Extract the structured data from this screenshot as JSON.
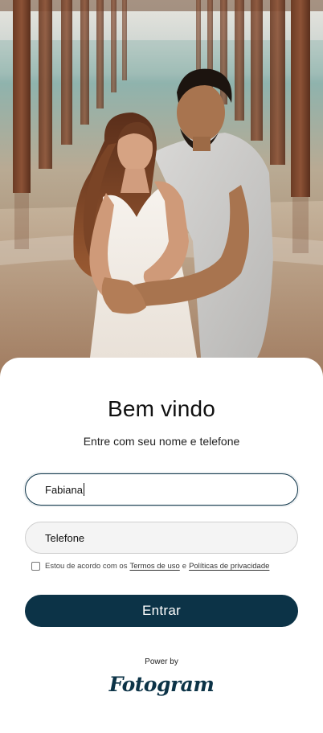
{
  "welcome": {
    "title": "Bem vindo",
    "subtitle": "Entre com seu nome e telefone"
  },
  "form": {
    "name_value": "Fabiana",
    "phone_placeholder": "Telefone",
    "consent_prefix": "Estou de acordo com os",
    "terms_link": "Termos de uso",
    "consent_joiner": "e",
    "privacy_link": "Políticas de privacidade",
    "consent_checked": false,
    "submit_label": "Entrar"
  },
  "footer": {
    "powered_by": "Power by",
    "brand_logo": "Fotogram"
  },
  "colors": {
    "primary": "#0c3347",
    "input_bg": "#f4f4f4"
  }
}
